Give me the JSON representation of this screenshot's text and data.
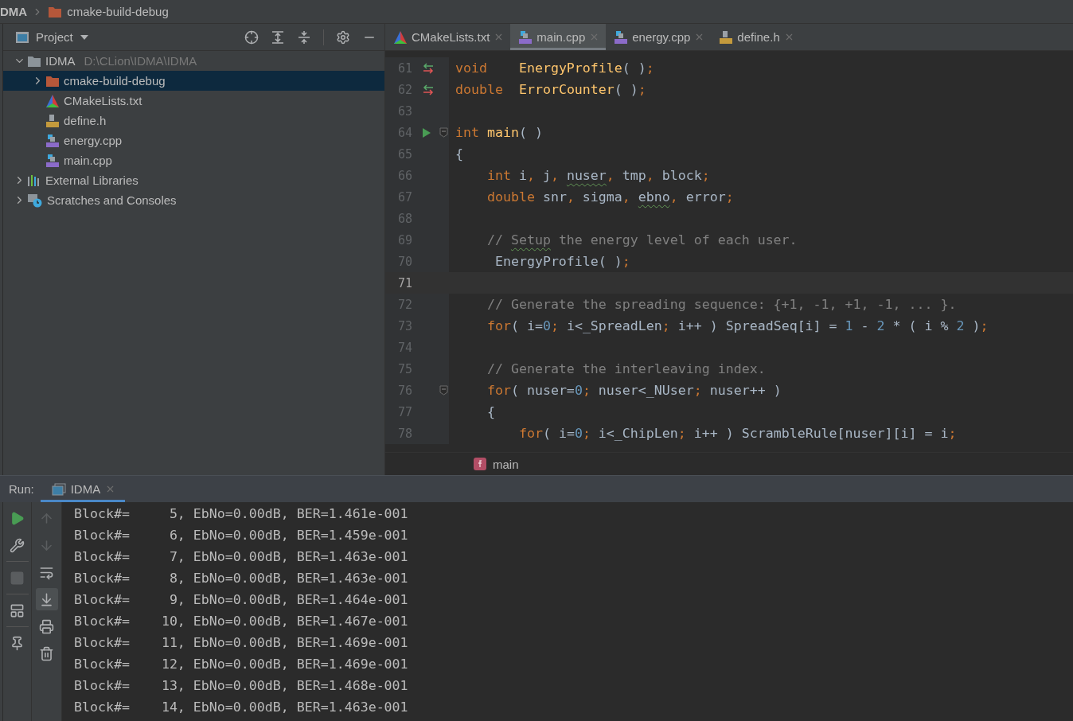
{
  "breadcrumb": {
    "items": [
      {
        "label": "DMA"
      },
      {
        "label": "cmake-build-debug",
        "kind": "folder"
      }
    ]
  },
  "project_panel": {
    "title": "Project",
    "tree": [
      {
        "label": "IDMA",
        "path": "D:\\CLion\\IDMA\\IDMA",
        "kind": "module",
        "expanded": true,
        "selected": false,
        "children": [
          {
            "label": "cmake-build-debug",
            "kind": "folder",
            "expanded": false,
            "selected": true
          },
          {
            "label": "CMakeLists.txt",
            "kind": "cmake",
            "selected": false
          },
          {
            "label": "define.h",
            "kind": "header",
            "selected": false
          },
          {
            "label": "energy.cpp",
            "kind": "cpp",
            "selected": false
          },
          {
            "label": "main.cpp",
            "kind": "cpp",
            "selected": false
          }
        ]
      },
      {
        "label": "External Libraries",
        "kind": "libraries",
        "expanded": false,
        "selected": false
      },
      {
        "label": "Scratches and Consoles",
        "kind": "scratches",
        "expanded": false,
        "selected": false
      }
    ]
  },
  "editor": {
    "tabs": [
      {
        "label": "CMakeLists.txt",
        "kind": "cmake",
        "selected": false
      },
      {
        "label": "main.cpp",
        "kind": "cpp",
        "selected": true
      },
      {
        "label": "energy.cpp",
        "kind": "cpp",
        "selected": false
      },
      {
        "label": "define.h",
        "kind": "header",
        "selected": false
      }
    ],
    "lines": [
      {
        "number": "61",
        "gutter": {
          "kind": "override"
        },
        "current": false,
        "tokens": [
          {
            "kind": "kw",
            "text": "void"
          },
          {
            "kind": "fn",
            "text": "    EnergyProfile"
          },
          {
            "kind": "id",
            "text": "( )"
          },
          {
            "kind": "p",
            "text": ";"
          }
        ]
      },
      {
        "number": "62",
        "gutter": {
          "kind": "override"
        },
        "current": false,
        "tokens": [
          {
            "kind": "kw",
            "text": "double"
          },
          {
            "kind": "fn",
            "text": "  ErrorCounter"
          },
          {
            "kind": "id",
            "text": "( )"
          },
          {
            "kind": "p",
            "text": ";"
          }
        ]
      },
      {
        "number": "63",
        "current": false
      },
      {
        "number": "64",
        "gutter": {
          "kind": "run"
        },
        "fold": true,
        "current": false,
        "tokens": [
          {
            "kind": "kw",
            "text": "int"
          },
          {
            "kind": "fn",
            "text": " main"
          },
          {
            "kind": "id",
            "text": "( )"
          }
        ]
      },
      {
        "number": "65",
        "current": false,
        "tokens": [
          {
            "kind": "id",
            "text": "{"
          }
        ]
      },
      {
        "number": "66",
        "current": false,
        "tokens": [
          {
            "kind": "kw",
            "text": "    int"
          },
          {
            "kind": "id",
            "text": " i"
          },
          {
            "kind": "p",
            "text": ","
          },
          {
            "kind": "id",
            "text": " j"
          },
          {
            "kind": "p",
            "text": ", "
          },
          {
            "kind": "id",
            "text": "nuser",
            "squiggle": true
          },
          {
            "kind": "p",
            "text": ","
          },
          {
            "kind": "id",
            "text": " tmp"
          },
          {
            "kind": "p",
            "text": ","
          },
          {
            "kind": "id",
            "text": " block"
          },
          {
            "kind": "p",
            "text": ";"
          }
        ]
      },
      {
        "number": "67",
        "current": false,
        "tokens": [
          {
            "kind": "kw",
            "text": "    double"
          },
          {
            "kind": "id",
            "text": " snr"
          },
          {
            "kind": "p",
            "text": ","
          },
          {
            "kind": "id",
            "text": " sigma"
          },
          {
            "kind": "p",
            "text": ", "
          },
          {
            "kind": "id",
            "text": "ebno",
            "squiggle": true
          },
          {
            "kind": "p",
            "text": ","
          },
          {
            "kind": "id",
            "text": " error"
          },
          {
            "kind": "p",
            "text": ";"
          }
        ]
      },
      {
        "number": "68",
        "current": false
      },
      {
        "number": "69",
        "current": false,
        "tokens": [
          {
            "kind": "c",
            "text": "    // "
          },
          {
            "kind": "c",
            "text": "Setup",
            "squiggle": true
          },
          {
            "kind": "c",
            "text": " the energy level of each user."
          }
        ]
      },
      {
        "number": "70",
        "current": false,
        "tokens": [
          {
            "kind": "id",
            "text": "     EnergyProfile( )"
          },
          {
            "kind": "p",
            "text": ";"
          }
        ]
      },
      {
        "number": "71",
        "current": true
      },
      {
        "number": "72",
        "current": false,
        "tokens": [
          {
            "kind": "c",
            "text": "    // Generate the spreading sequence: {+1, -1, +1, -1, ... }."
          }
        ]
      },
      {
        "number": "73",
        "current": false,
        "tokens": [
          {
            "kind": "kw",
            "text": "    for"
          },
          {
            "kind": "id",
            "text": "( i="
          },
          {
            "kind": "n",
            "text": "0"
          },
          {
            "kind": "p",
            "text": ";"
          },
          {
            "kind": "id",
            "text": " i<_SpreadLen"
          },
          {
            "kind": "p",
            "text": ";"
          },
          {
            "kind": "id",
            "text": " i++ ) SpreadSeq[i] = "
          },
          {
            "kind": "n",
            "text": "1"
          },
          {
            "kind": "id",
            "text": " - "
          },
          {
            "kind": "n",
            "text": "2"
          },
          {
            "kind": "id",
            "text": " * ( i % "
          },
          {
            "kind": "n",
            "text": "2"
          },
          {
            "kind": "id",
            "text": " )"
          },
          {
            "kind": "p",
            "text": ";"
          }
        ]
      },
      {
        "number": "74",
        "current": false
      },
      {
        "number": "75",
        "current": false,
        "tokens": [
          {
            "kind": "c",
            "text": "    // Generate the interleaving index."
          }
        ]
      },
      {
        "number": "76",
        "fold": true,
        "current": false,
        "tokens": [
          {
            "kind": "kw",
            "text": "    for"
          },
          {
            "kind": "id",
            "text": "( nuser="
          },
          {
            "kind": "n",
            "text": "0"
          },
          {
            "kind": "p",
            "text": ";"
          },
          {
            "kind": "id",
            "text": " nuser<_NUser"
          },
          {
            "kind": "p",
            "text": ";"
          },
          {
            "kind": "id",
            "text": " nuser++ )"
          }
        ]
      },
      {
        "number": "77",
        "current": false,
        "tokens": [
          {
            "kind": "id",
            "text": "    {"
          }
        ]
      },
      {
        "number": "78",
        "current": false,
        "tokens": [
          {
            "kind": "kw",
            "text": "        for"
          },
          {
            "kind": "id",
            "text": "( i="
          },
          {
            "kind": "n",
            "text": "0"
          },
          {
            "kind": "p",
            "text": ";"
          },
          {
            "kind": "id",
            "text": " i<_ChipLen"
          },
          {
            "kind": "p",
            "text": ";"
          },
          {
            "kind": "id",
            "text": " i++ ) ScrambleRule[nuser][i] = i"
          },
          {
            "kind": "p",
            "text": ";"
          }
        ]
      }
    ],
    "breadcrumb": {
      "label": "main",
      "kind": "function"
    }
  },
  "run_panel": {
    "label": "Run:",
    "tabs": [
      {
        "label": "IDMA",
        "selected": true
      }
    ],
    "tools": [
      {
        "kind": "rerun"
      },
      {
        "kind": "wrench"
      },
      {
        "kind": "stop",
        "disabled": true
      },
      {
        "kind": "layout"
      },
      {
        "kind": "pin"
      }
    ],
    "output_tools": [
      {
        "kind": "up",
        "on": false
      },
      {
        "kind": "down",
        "on": false
      },
      {
        "kind": "wrap",
        "on": false
      },
      {
        "kind": "scroll-end",
        "on": true
      },
      {
        "kind": "print",
        "on": false
      },
      {
        "kind": "trash",
        "on": false
      }
    ],
    "output": [
      "Block#=     5, EbNo=0.00dB, BER=1.461e-001",
      "Block#=     6, EbNo=0.00dB, BER=1.459e-001",
      "Block#=     7, EbNo=0.00dB, BER=1.463e-001",
      "Block#=     8, EbNo=0.00dB, BER=1.463e-001",
      "Block#=     9, EbNo=0.00dB, BER=1.464e-001",
      "Block#=    10, EbNo=0.00dB, BER=1.467e-001",
      "Block#=    11, EbNo=0.00dB, BER=1.469e-001",
      "Block#=    12, EbNo=0.00dB, BER=1.469e-001",
      "Block#=    13, EbNo=0.00dB, BER=1.468e-001",
      "Block#=    14, EbNo=0.00dB, BER=1.463e-001"
    ]
  }
}
